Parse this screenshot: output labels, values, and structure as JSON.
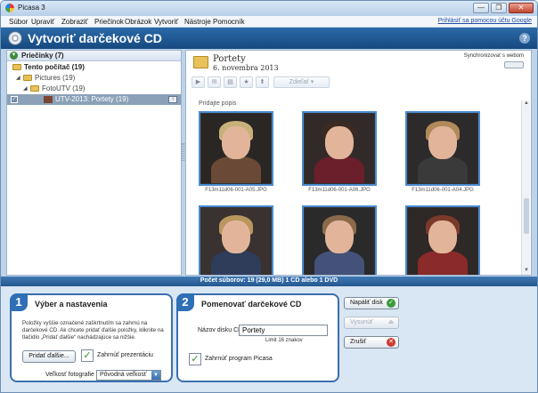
{
  "window": {
    "title": "Picasa 3",
    "minimize": "—",
    "restore": "❐",
    "close": "✕"
  },
  "menu": {
    "items": [
      "Súbor",
      "Upraviť",
      "Zobraziť",
      "Priečinok",
      "Obrázok",
      "Vytvoriť",
      "Nástroje",
      "Pomocník"
    ],
    "signin": "Prihlásiť sa pomocou účtu Google"
  },
  "mode": {
    "title": "Vytvoriť darčekové CD",
    "help": "?"
  },
  "left": {
    "header": "Priečinky (7)",
    "tree": [
      {
        "label": "Tento počítač (19)"
      },
      {
        "label": "Pictures (19)"
      },
      {
        "label": "FotoUTV (19)"
      },
      {
        "label": "UTV-2013: Portety (19)"
      }
    ]
  },
  "album": {
    "title": "Portety",
    "date": "6. novembra 2013",
    "sync_label": "Synchronizovať s webom",
    "share_label": "Zdieľať",
    "caption": "Pridajte popis"
  },
  "thumbnails": [
    {
      "label": "F13m11d06-001-A05.JPG",
      "hair": "#c8b07a",
      "body": "#6a4a36",
      "bg": "#2a2624"
    },
    {
      "label": "F13m11d06-001-A06.JPG",
      "hair": "#3a2a22",
      "body": "#6b1f2a",
      "bg": "#322a28"
    },
    {
      "label": "F13m11d06-001-A04.JPG",
      "hair": "#b08a5a",
      "body": "#3a3a3a",
      "bg": "#2c2a2a"
    },
    {
      "label": "",
      "hair": "#b9975f",
      "body": "#2f3c5a",
      "bg": "#3a3230"
    },
    {
      "label": "",
      "hair": "#8a6a4a",
      "body": "#44527a",
      "bg": "#2a2a2a"
    },
    {
      "label": "",
      "hair": "#7a3a2a",
      "body": "#8a2a2a",
      "bg": "#2e2826"
    }
  ],
  "status": {
    "text": "Počet súborov: 19 (29,0 MB) 1 CD alebo 1 DVD"
  },
  "step1": {
    "num": "1",
    "title": "Výber a nastavenia",
    "desc": "Položky vyššie označené zaškrtnutím sa zahrnú na darčekové CD. Ak chcete pridať ďalšie položky, kliknite na tlačidlo „Pridať ďalšie“ nachádzajúce sa nižšie.",
    "add_more": "Pridať ďalšie...",
    "include_presentation": "Zahrnúť prezentáciu",
    "photo_size_label": "Veľkosť fotografie",
    "photo_size_value": "Pôvodná veľkosť",
    "check": "✓"
  },
  "step2": {
    "num": "2",
    "title": "Pomenovať darčekové CD",
    "disc_name_label": "Názov disku CD",
    "disc_name_value": "Portety",
    "limit_hint": "Limit 16 znakov",
    "include_picasa": "Zahrnúť program Picasa",
    "check": "✓"
  },
  "actions": {
    "burn": "Napáliť disk",
    "eject": "Vysunúť",
    "cancel": "Zrušiť"
  }
}
